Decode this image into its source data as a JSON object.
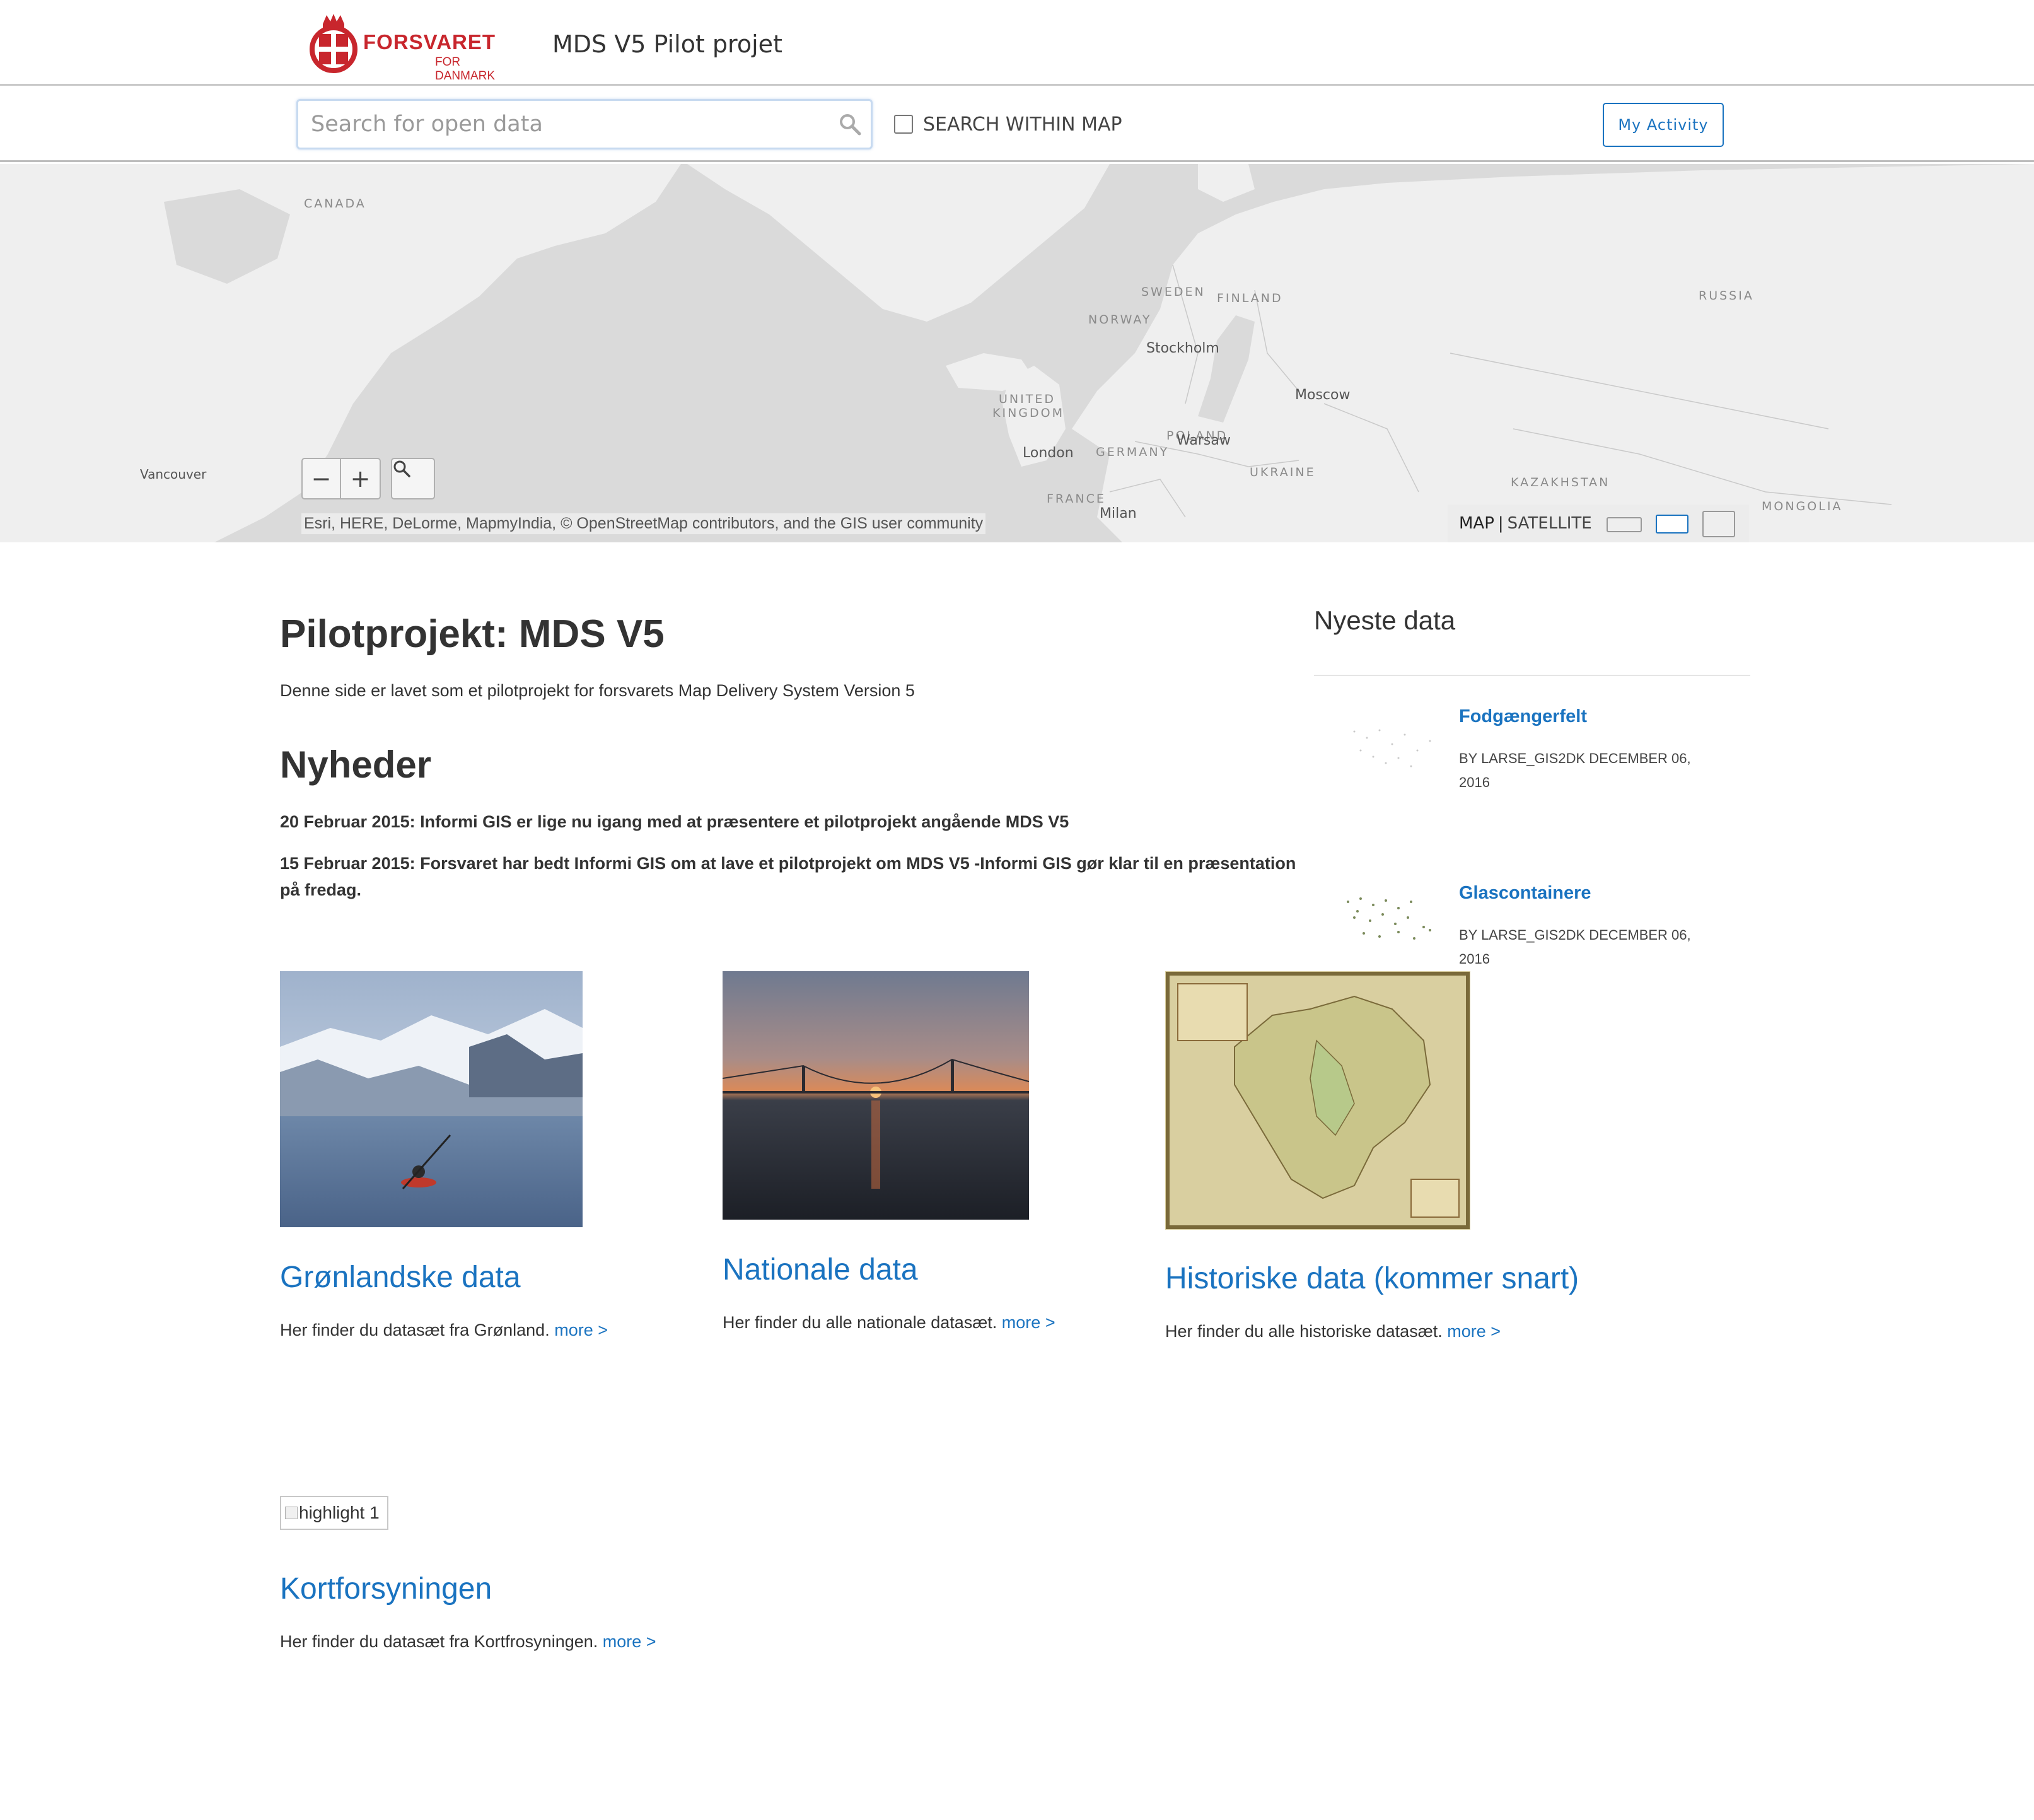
{
  "header": {
    "logo_main": "FORSVARET",
    "logo_sub": "FOR DANMARK",
    "site_title": "MDS V5 Pilot projet"
  },
  "search": {
    "placeholder": "Search for open data",
    "within_map_label": "SEARCH WITHIN MAP",
    "my_activity_label": "My Activity"
  },
  "map": {
    "labels": {
      "canada": "CANADA",
      "vancouver": "Vancouver",
      "sweden": "SWEDEN",
      "finland": "FINLAND",
      "norway": "NORWAY",
      "stockholm": "Stockholm",
      "russia": "RUSSIA",
      "uk_line1": "UNITED",
      "uk_line2": "KINGDOM",
      "moscow": "Moscow",
      "london": "London",
      "germany": "GERMANY",
      "poland": "POLAND",
      "warsaw": "Warsaw",
      "ukraine": "UKRAINE",
      "kazakhstan": "KAZAKHSTAN",
      "france": "FRANCE",
      "milan": "Milan",
      "mongolia": "MONGOLIA"
    },
    "zoom_out": "−",
    "zoom_in": "+",
    "attribution": "Esri, HERE, DeLorme, MapmyIndia, © OpenStreetMap contributors, and the GIS user community",
    "basemap_map": "MAP",
    "basemap_separator": "|",
    "basemap_satellite": "SATELLITE",
    "icons": {
      "zoom": "magnifier-icon",
      "search": "search-icon"
    }
  },
  "main": {
    "title": "Pilotprojekt: MDS V5",
    "intro": "Denne side er lavet som et pilotprojekt for forsvarets Map Delivery System Version 5",
    "news_heading": "Nyheder",
    "news": [
      "20 Februar 2015: Informi GIS er lige nu igang med at præsentere et pilotprojekt angående MDS V5",
      "15 Februar 2015: Forsvaret har bedt Informi GIS om at lave et pilotprojekt om MDS V5 -Informi GIS gør klar til en præsentation på fredag."
    ]
  },
  "sidebar": {
    "title": "Nyeste data",
    "items": [
      {
        "title": "Fodgængerfelt",
        "meta": "BY LARSE_GIS2DK DECEMBER 06, 2016"
      },
      {
        "title": "Glascontainere",
        "meta": "BY LARSE_GIS2DK DECEMBER 06, 2016"
      }
    ]
  },
  "cards": [
    {
      "title": "Grønlandske data",
      "desc": "Her finder du datasæt fra Grønland.",
      "more": "more >"
    },
    {
      "title": "Nationale data",
      "desc": "Her finder du alle nationale datasæt.",
      "more": "more >"
    },
    {
      "title": "Historiske data (kommer snart)",
      "desc": "Her finder du alle historiske datasæt.",
      "more": "more >"
    }
  ],
  "highlight": {
    "alt": "highlight 1",
    "title": "Kortforsyningen",
    "desc": "Her finder du datasæt fra Kortfrosyningen.",
    "more": "more >"
  },
  "colors": {
    "brand_red": "#c8262d",
    "link_blue": "#1a73c0",
    "map_water": "#dadada",
    "map_land": "#efefef"
  }
}
